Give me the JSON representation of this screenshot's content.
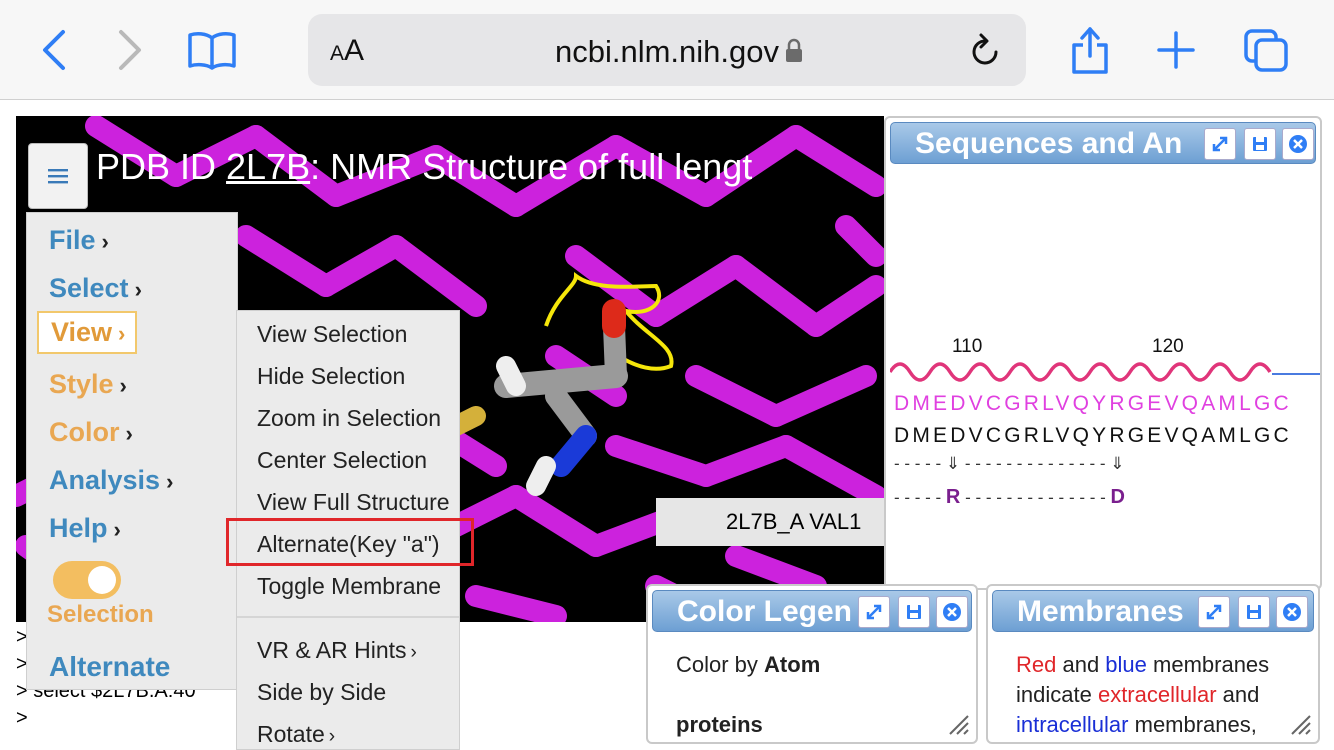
{
  "browser": {
    "text_size_label": "AA",
    "url": "ncbi.nlm.nih.gov",
    "icons": [
      "back-icon",
      "forward-icon",
      "bookmarks-icon",
      "lock-icon",
      "reload-icon",
      "share-icon",
      "new-tab-icon",
      "tabs-icon"
    ]
  },
  "viewer": {
    "title_prefix": "PDB ID ",
    "pdb_id": "2L7B",
    "title_suffix": ": NMR Structure of full lengt",
    "hover_label": "2L7B_A VAL1",
    "background": "#000000",
    "molecule_color": "#cc22dd"
  },
  "console": {
    "lines": [
      ">",
      ">",
      "> select $2L7B.A:40",
      ">"
    ]
  },
  "menu": {
    "items": [
      "File",
      "Select",
      "View",
      "Style",
      "Color",
      "Analysis",
      "Help"
    ],
    "active": "View",
    "toggle_label": "Selection",
    "alternate_label": "Alternate"
  },
  "submenu": {
    "items": [
      "View Selection",
      "Hide Selection",
      "Zoom in Selection",
      "Center Selection",
      "View Full Structure",
      "Alternate(Key \"a\")",
      "Toggle Membrane",
      "VR & AR Hints",
      "Side by Side",
      "Rotate"
    ],
    "highlighted": "Alternate(Key \"a\")"
  },
  "sequences": {
    "title": "Sequences and An",
    "ruler": [
      "110",
      "120"
    ],
    "seq_structure": "DMEDVCGRLVQYRGEVQAMLGC",
    "seq_reference": "DMEDVCGRLVQYRGEVQAMLGC",
    "arrow_row": "- - - - - ⇓ - - - - - - - - - - - - - - ⇓",
    "annotation_row_a": "- - - - - ",
    "annotation_R": "R",
    "annotation_row_b": " - - - - - - - - - - - - - - ",
    "annotation_D": "D"
  },
  "color_legend": {
    "title": "Color Legen",
    "line1_prefix": "Color by ",
    "line1_bold": "Atom",
    "line2": "proteins"
  },
  "membranes": {
    "title": "Membranes",
    "red_word": "Red",
    "and1": " and ",
    "blue_word": "blue",
    "tail1": " membranes",
    "line2_prefix": "indicate ",
    "extracellular": "extracellular",
    "line2_suffix": " and",
    "intracellular": "intracellular",
    "line3_suffix": " membranes,",
    "colors": {
      "red": "#e0262a",
      "blue": "#1a2fd6"
    }
  }
}
